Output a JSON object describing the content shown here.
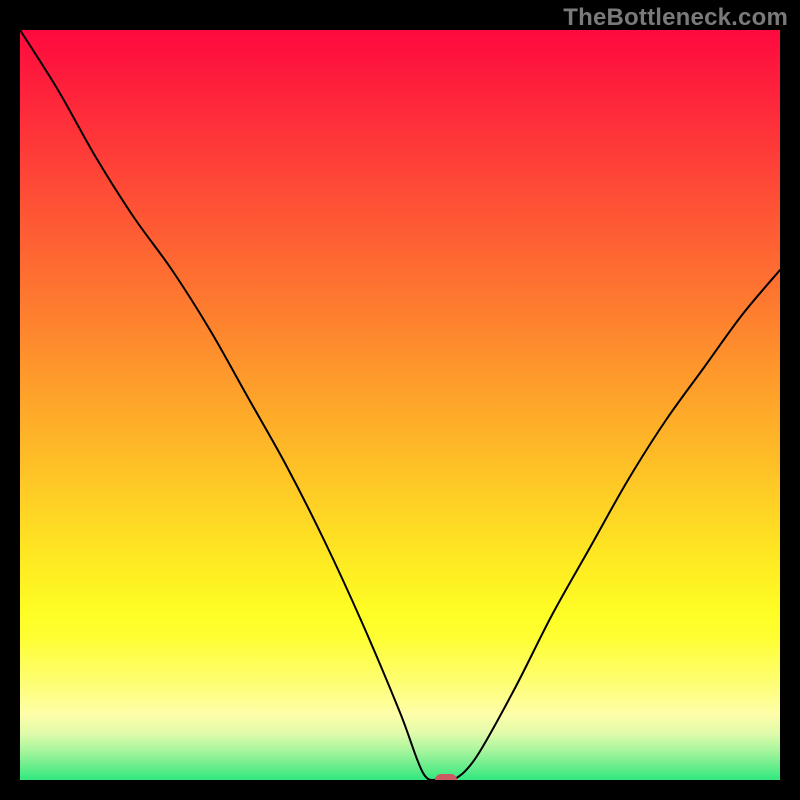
{
  "watermark": "TheBottleneck.com",
  "colors": {
    "marker": "#cc5a63",
    "curve_stroke": "#000000",
    "gradient_stops": [
      {
        "offset": 0.0,
        "color": "#fe093e"
      },
      {
        "offset": 0.07,
        "color": "#fe1f3c"
      },
      {
        "offset": 0.14,
        "color": "#fe3539"
      },
      {
        "offset": 0.21,
        "color": "#fe4b36"
      },
      {
        "offset": 0.28,
        "color": "#fe6133"
      },
      {
        "offset": 0.35,
        "color": "#fe7730"
      },
      {
        "offset": 0.42,
        "color": "#fe8e2d"
      },
      {
        "offset": 0.49,
        "color": "#fea52a"
      },
      {
        "offset": 0.56,
        "color": "#febc27"
      },
      {
        "offset": 0.63,
        "color": "#fed324"
      },
      {
        "offset": 0.7,
        "color": "#feea22"
      },
      {
        "offset": 0.77,
        "color": "#fefe25"
      },
      {
        "offset": 0.8,
        "color": "#fefe33"
      },
      {
        "offset": 0.86,
        "color": "#fefe75"
      },
      {
        "offset": 0.9,
        "color": "#fefea9"
      },
      {
        "offset": 0.925,
        "color": "#e1fbab"
      },
      {
        "offset": 0.945,
        "color": "#b0f69f"
      },
      {
        "offset": 0.962,
        "color": "#7ef092"
      },
      {
        "offset": 0.978,
        "color": "#4ceb85"
      },
      {
        "offset": 0.995,
        "color": "#19e578"
      },
      {
        "offset": 1.0,
        "color": "#19e578"
      }
    ]
  },
  "chart_data": {
    "type": "line",
    "title": "",
    "xlabel": "",
    "ylabel": "",
    "xlim": [
      0,
      100
    ],
    "ylim": [
      0,
      100
    ],
    "x": [
      0,
      5,
      10,
      15,
      20,
      25,
      30,
      35,
      40,
      45,
      50,
      53,
      55,
      57,
      60,
      65,
      70,
      75,
      80,
      85,
      90,
      95,
      100
    ],
    "values": [
      100,
      92,
      83,
      75,
      68,
      60,
      51,
      42,
      32,
      21,
      9,
      1,
      0,
      0,
      3,
      12,
      22,
      31,
      40,
      48,
      55,
      62,
      68
    ],
    "marker": {
      "x": 56,
      "y": 0
    }
  }
}
